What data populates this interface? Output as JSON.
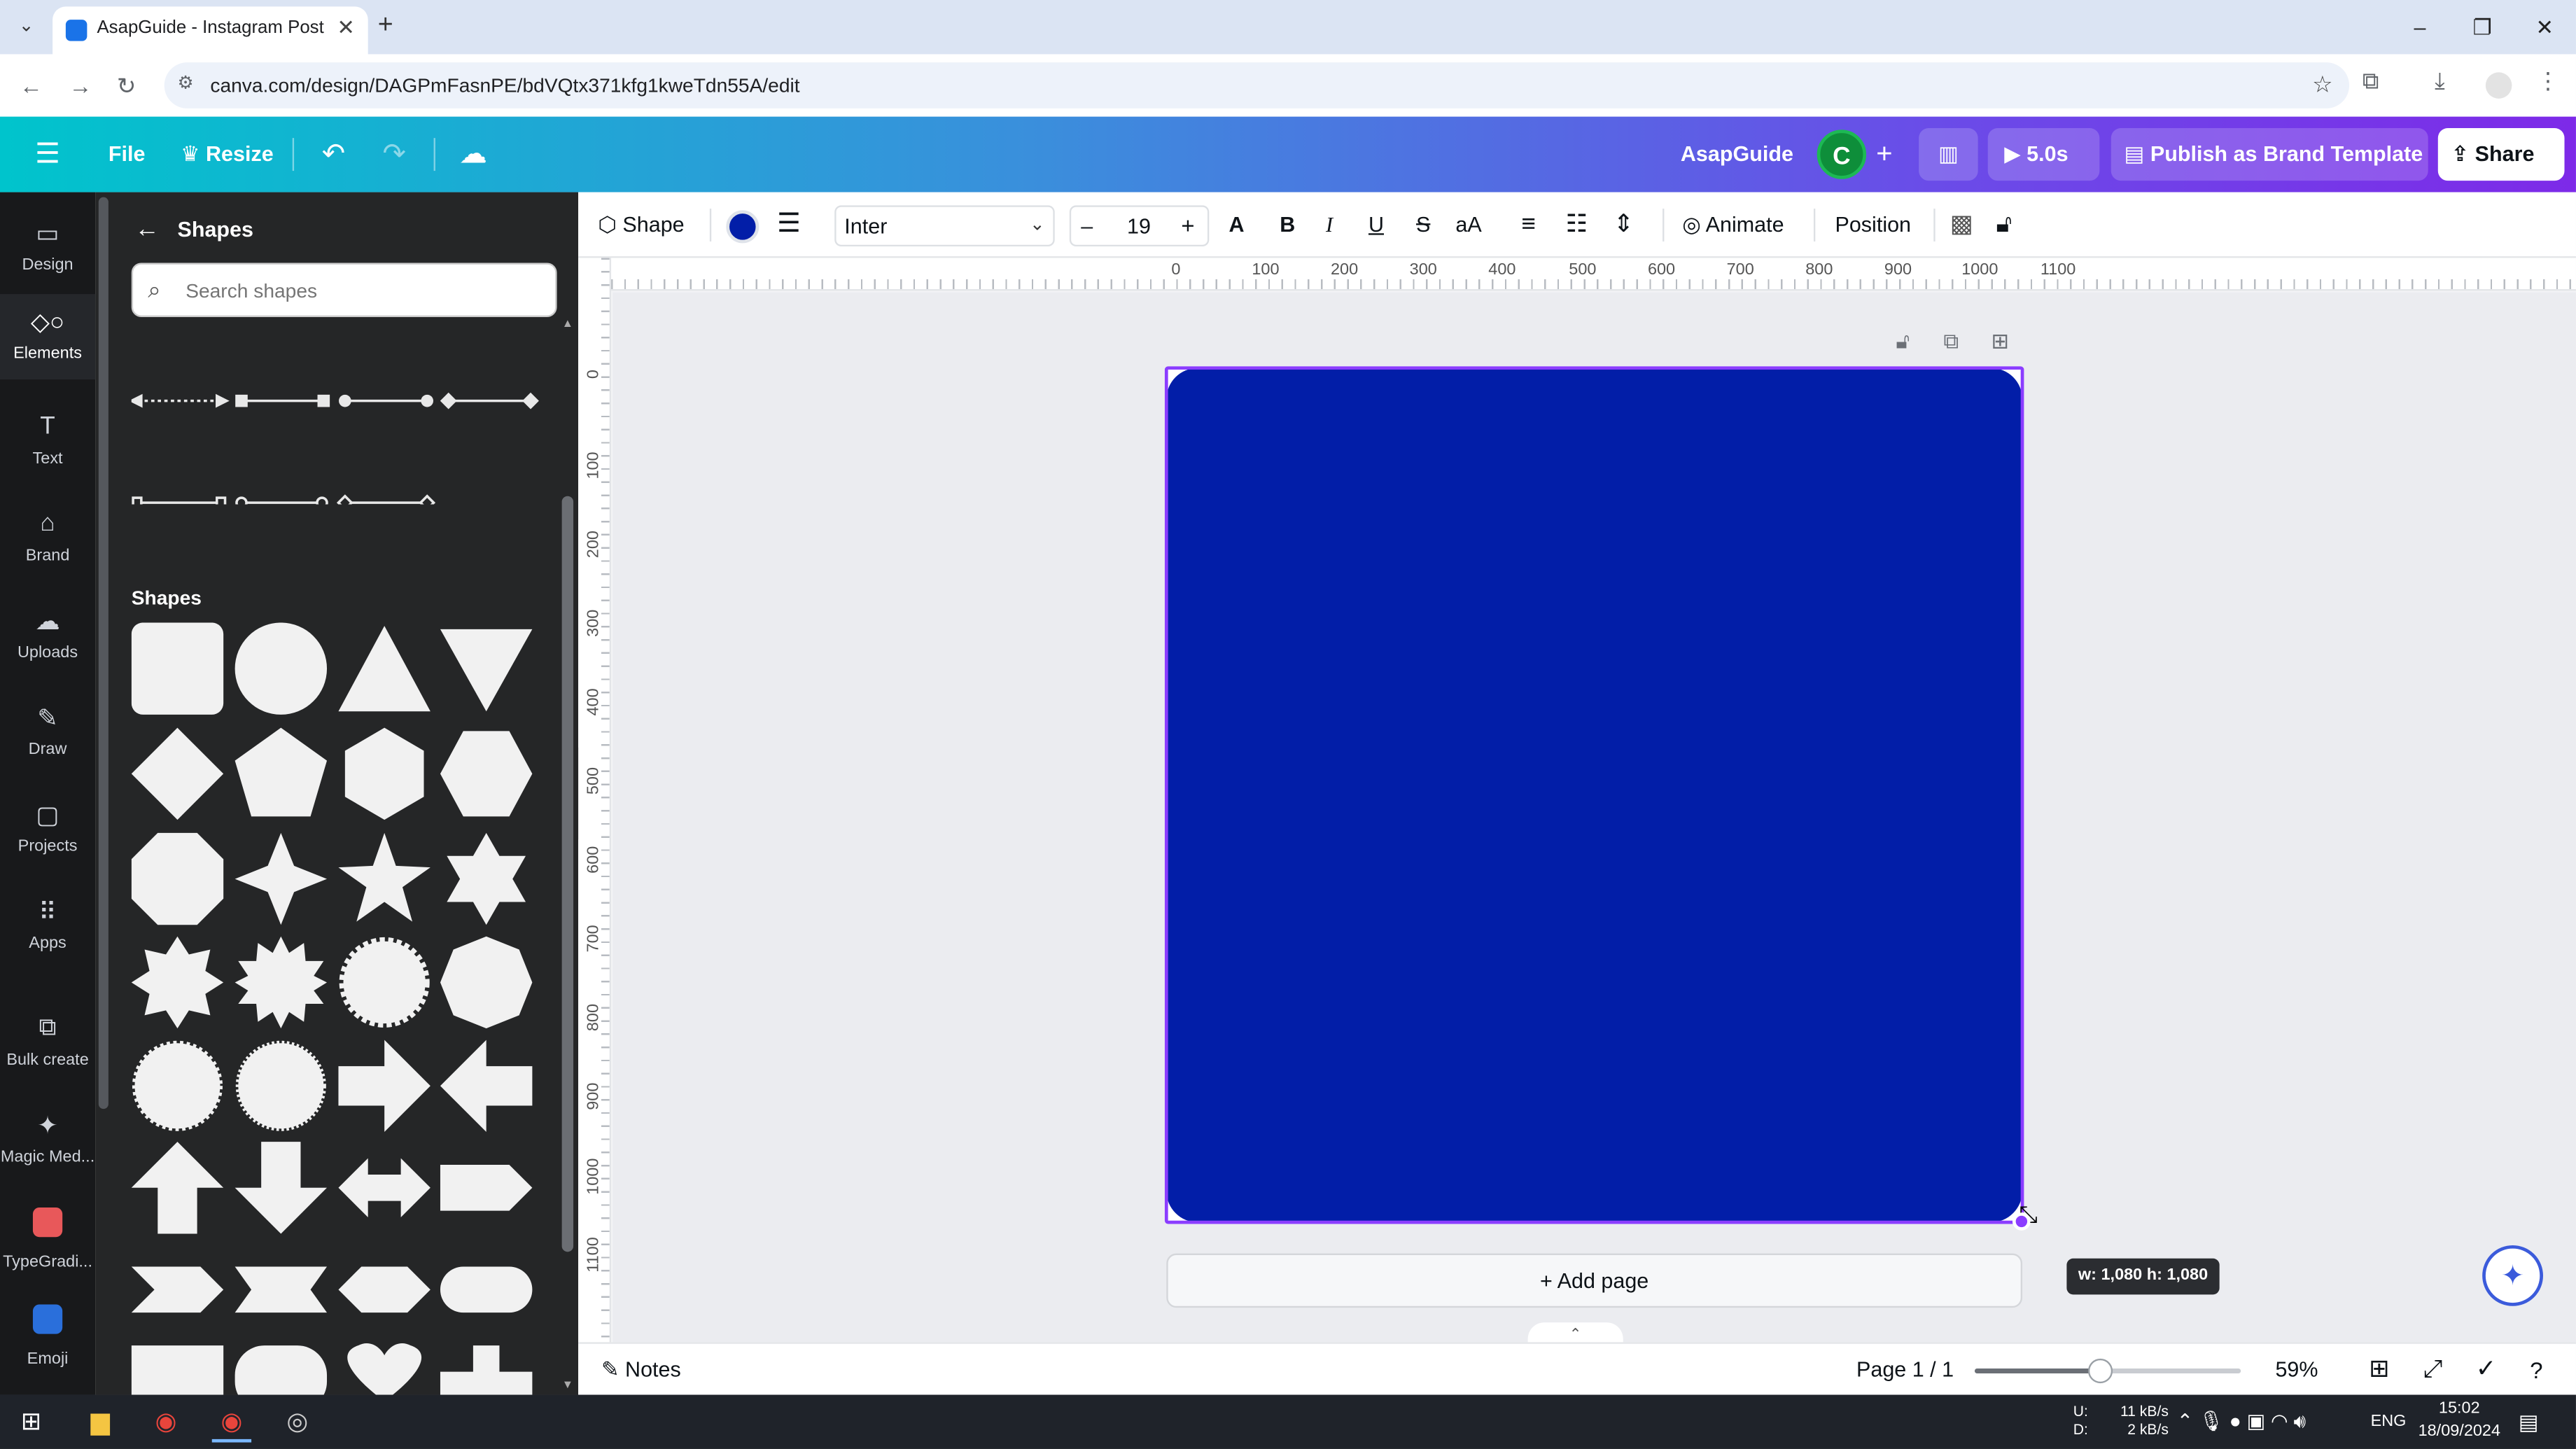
{
  "browser": {
    "tab_title": "AsapGuide - Instagram Post",
    "tab_close": "✕",
    "new_tab": "+",
    "url": "canva.com/design/DAGPmFasnPE/bdVQtx371kfg1kweTdn55A/edit",
    "window_controls": [
      "–",
      "❐",
      "✕"
    ]
  },
  "header": {
    "file": "File",
    "resize": "Resize",
    "brand_name": "AsapGuide",
    "avatar_letter": "C",
    "duration": "5.0s",
    "publish": "Publish as Brand Template",
    "share": "Share"
  },
  "rail": [
    {
      "label": "Design",
      "icon": "design-icon",
      "glyph": "▭"
    },
    {
      "label": "Elements",
      "icon": "elements-icon",
      "glyph": "◇○"
    },
    {
      "label": "Text",
      "icon": "text-icon",
      "glyph": "T"
    },
    {
      "label": "Brand",
      "icon": "brand-icon",
      "glyph": "⌂"
    },
    {
      "label": "Uploads",
      "icon": "uploads-icon",
      "glyph": "☁"
    },
    {
      "label": "Draw",
      "icon": "draw-icon",
      "glyph": "✎"
    },
    {
      "label": "Projects",
      "icon": "projects-icon",
      "glyph": "▢"
    },
    {
      "label": "Apps",
      "icon": "apps-icon",
      "glyph": "⠿"
    },
    {
      "label": "Bulk create",
      "icon": "bulk-create-icon",
      "glyph": "⧉"
    },
    {
      "label": "Magic Med...",
      "icon": "magic-media-icon",
      "glyph": "✦"
    },
    {
      "label": "TypeGradi...",
      "icon": "typegradient-app-icon",
      "glyph": ""
    },
    {
      "label": "Emoji",
      "icon": "emoji-app-icon",
      "glyph": ""
    }
  ],
  "panel": {
    "title": "Shapes",
    "search_placeholder": "Search shapes",
    "section_title": "Shapes"
  },
  "toolbar": {
    "shape": "Shape",
    "shape_color": "#021ea8",
    "font": "Inter",
    "font_size": "19",
    "animate": "Animate",
    "position": "Position",
    "text_case": "aA"
  },
  "rulers": {
    "h_labels": [
      "0",
      "100",
      "200",
      "300",
      "400",
      "500",
      "600",
      "700",
      "800",
      "900",
      "1000",
      "1100"
    ],
    "v_labels": [
      "0",
      "100",
      "200",
      "300",
      "400",
      "500",
      "600",
      "700",
      "800",
      "900",
      "1000",
      "1100"
    ]
  },
  "canvas": {
    "add_page": "+ Add page",
    "dimensions": "w: 1,080 h: 1,080"
  },
  "bottom": {
    "notes": "Notes",
    "page_indicator": "Page 1 / 1",
    "zoom": "59%",
    "zoom_value": 59
  },
  "taskbar": {
    "net_up_label": "U:",
    "net_down_label": "D:",
    "net_up": "11 kB/s",
    "net_down": "2 kB/s",
    "lang": "ENG",
    "time": "15:02",
    "date": "18/09/2024"
  },
  "colors": {
    "shape_fill": "#021ea8",
    "selection": "#8b3dff",
    "header_start": "#00c4cc",
    "header_end": "#7d2ae8"
  }
}
